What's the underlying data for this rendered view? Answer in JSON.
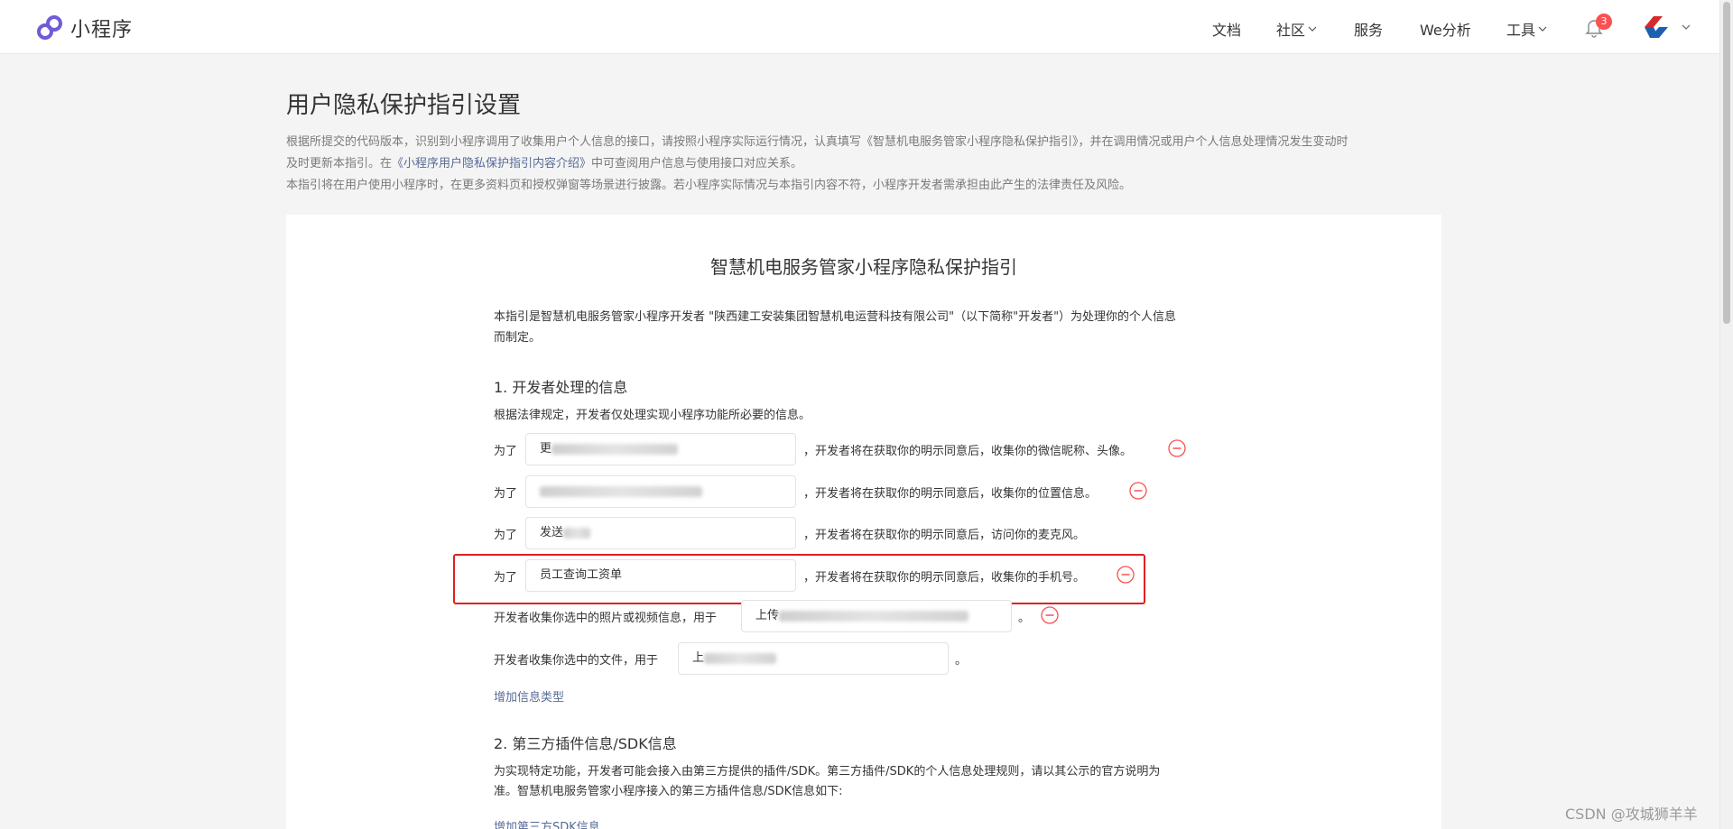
{
  "header": {
    "logo_text": "小程序",
    "nav": [
      {
        "label": "文档"
      },
      {
        "label": "社区"
      },
      {
        "label": "服务"
      },
      {
        "label": "We分析"
      },
      {
        "label": "工具"
      }
    ],
    "notification_count": "3"
  },
  "page": {
    "title": "用户隐私保护指引设置",
    "intro_line1": "根据所提交的代码版本，识别到小程序调用了收集用户个人信息的接口，请按照小程序实际运行情况，认真填写《智慧机电服务管家小程序隐私保护指引》，并在调用情况或用户个人信息处理情况发生变动时",
    "intro_line2_a": "及时更新本指引。在",
    "intro_line2_link": "《小程序用户隐私保护指引内容介绍》",
    "intro_line2_b": "中可查阅用户信息与使用接口对应关系。",
    "intro_line3": "本指引将在用户使用小程序时，在更多资料页和授权弹窗等场景进行披露。若小程序实际情况与本指引内容不符，小程序开发者需承担由此产生的法律责任及风险。"
  },
  "doc": {
    "title": "智慧机电服务管家小程序隐私保护指引",
    "preamble_1": "本指引是智慧机电服务管家小程序开发者 \"陕西建工安装集团智慧机电运营科技有限公司\"（以下简称\"开发者\"）为处理你的个人信息",
    "preamble_2": "而制定。",
    "section1_title": "1. 开发者处理的信息",
    "section1_desc": "根据法律规定，开发者仅处理实现小程序功能所必要的信息。",
    "rows": [
      {
        "prefix": "为了",
        "value": "更",
        "suffix": "，开发者将在获取你的明示同意后，收集你的微信昵称、头像。"
      },
      {
        "prefix": "为了",
        "value": "",
        "suffix": "，开发者将在获取你的明示同意后，收集你的位置信息。"
      },
      {
        "prefix": "为了",
        "value": "发送",
        "suffix": "，开发者将在获取你的明示同意后，访问你的麦克风。"
      },
      {
        "prefix": "为了",
        "value": "员工查询工资单",
        "suffix": "，开发者将在获取你的明示同意后，收集你的手机号。"
      }
    ],
    "photo_row": {
      "prefix": "开发者收集你选中的照片或视频信息，用于",
      "value": "上传",
      "suffix": "。"
    },
    "file_row": {
      "prefix": "开发者收集你选中的文件，用于",
      "value": "上",
      "suffix": "。"
    },
    "add_info_type": "增加信息类型",
    "section2_title": "2. 第三方插件信息/SDK信息",
    "section2_desc_1": "为实现特定功能，开发者可能会接入由第三方提供的插件/SDK。第三方插件/SDK的个人信息处理规则，请以其公示的官方说明为",
    "section2_desc_2": "准。智慧机电服务管家小程序接入的第三方插件信息/SDK信息如下:",
    "add_sdk": "增加第三方SDK信息"
  },
  "watermark": "CSDN @攻城狮羊羊",
  "colors": {
    "link": "#576b95",
    "danger": "#fa5151",
    "highlight": "#e02020"
  }
}
